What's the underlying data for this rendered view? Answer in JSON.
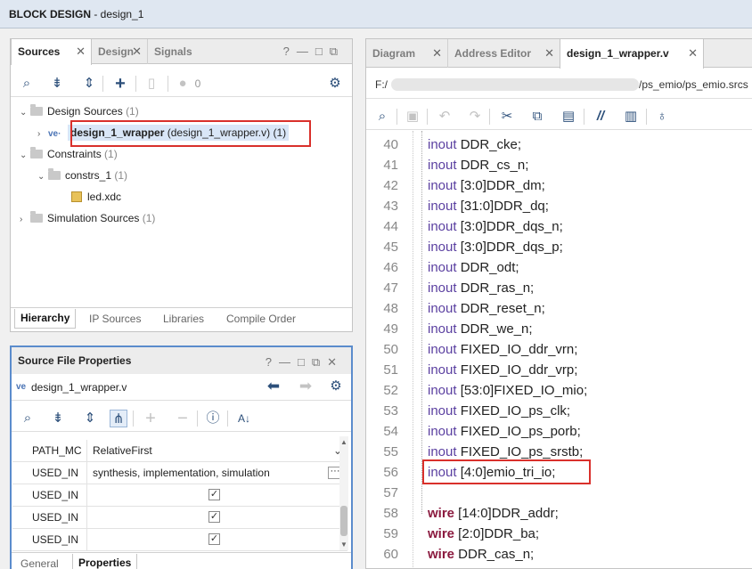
{
  "window": {
    "title_bold": "BLOCK DESIGN",
    "title_rest": " - design_1"
  },
  "sources_panel": {
    "tabs": [
      "Sources",
      "Design",
      "Signals"
    ],
    "toolbar": {
      "badge_count": "0"
    },
    "tree": {
      "design_sources": {
        "label": "Design Sources",
        "count": "(1)"
      },
      "top_module": {
        "name": "design_1_wrapper",
        "detail": "(design_1_wrapper.v) (1)"
      },
      "constraints": {
        "label": "Constraints",
        "count": "(1)"
      },
      "constrs_1": {
        "label": "constrs_1",
        "count": "(1)"
      },
      "led_xdc": {
        "label": "led.xdc"
      },
      "sim_sources": {
        "label": "Simulation Sources",
        "count": "(1)"
      }
    },
    "bottom_tabs": [
      "Hierarchy",
      "IP Sources",
      "Libraries",
      "Compile Order"
    ]
  },
  "props_panel": {
    "title": "Source File Properties",
    "file": "design_1_wrapper.v",
    "rows": [
      {
        "name": "PATH_MC",
        "value": "RelativeFirst",
        "kind": "dropdown"
      },
      {
        "name": "USED_IN",
        "value": "synthesis, implementation, simulation",
        "kind": "text"
      },
      {
        "name": "USED_IN",
        "value": "✓",
        "kind": "check"
      },
      {
        "name": "USED_IN",
        "value": "✓",
        "kind": "check"
      },
      {
        "name": "USED_IN",
        "value": "✓",
        "kind": "check"
      }
    ],
    "bottom_tabs": [
      "General",
      "Properties"
    ]
  },
  "editor": {
    "tabs": [
      "Diagram",
      "Address Editor",
      "design_1_wrapper.v"
    ],
    "path_start": "F:/",
    "path_end": "/ps_emio/ps_emio.srcs",
    "lines": [
      {
        "n": "40",
        "kw": "inout",
        "rest": " DDR_cke;"
      },
      {
        "n": "41",
        "kw": "inout",
        "rest": " DDR_cs_n;"
      },
      {
        "n": "42",
        "kw": "inout",
        "rest": " [3:0]DDR_dm;"
      },
      {
        "n": "43",
        "kw": "inout",
        "rest": " [31:0]DDR_dq;"
      },
      {
        "n": "44",
        "kw": "inout",
        "rest": " [3:0]DDR_dqs_n;"
      },
      {
        "n": "45",
        "kw": "inout",
        "rest": " [3:0]DDR_dqs_p;"
      },
      {
        "n": "46",
        "kw": "inout",
        "rest": " DDR_odt;"
      },
      {
        "n": "47",
        "kw": "inout",
        "rest": " DDR_ras_n;"
      },
      {
        "n": "48",
        "kw": "inout",
        "rest": " DDR_reset_n;"
      },
      {
        "n": "49",
        "kw": "inout",
        "rest": " DDR_we_n;"
      },
      {
        "n": "50",
        "kw": "inout",
        "rest": " FIXED_IO_ddr_vrn;"
      },
      {
        "n": "51",
        "kw": "inout",
        "rest": " FIXED_IO_ddr_vrp;"
      },
      {
        "n": "52",
        "kw": "inout",
        "rest": " [53:0]FIXED_IO_mio;"
      },
      {
        "n": "53",
        "kw": "inout",
        "rest": " FIXED_IO_ps_clk;"
      },
      {
        "n": "54",
        "kw": "inout",
        "rest": " FIXED_IO_ps_porb;"
      },
      {
        "n": "55",
        "kw": "inout",
        "rest": " FIXED_IO_ps_srstb;"
      },
      {
        "n": "56",
        "kw": "inout",
        "rest": " [4:0]emio_tri_io;"
      },
      {
        "n": "57",
        "kw": "",
        "rest": ""
      },
      {
        "n": "58",
        "kw": "wire",
        "rest": " [14:0]DDR_addr;"
      },
      {
        "n": "59",
        "kw": "wire",
        "rest": " [2:0]DDR_ba;"
      },
      {
        "n": "60",
        "kw": "wire",
        "rest": " DDR_cas_n;"
      }
    ]
  },
  "colors": {
    "highlight_box": "#d9302b",
    "inout": "#5a3fa0",
    "wire": "#8b1a3f"
  }
}
